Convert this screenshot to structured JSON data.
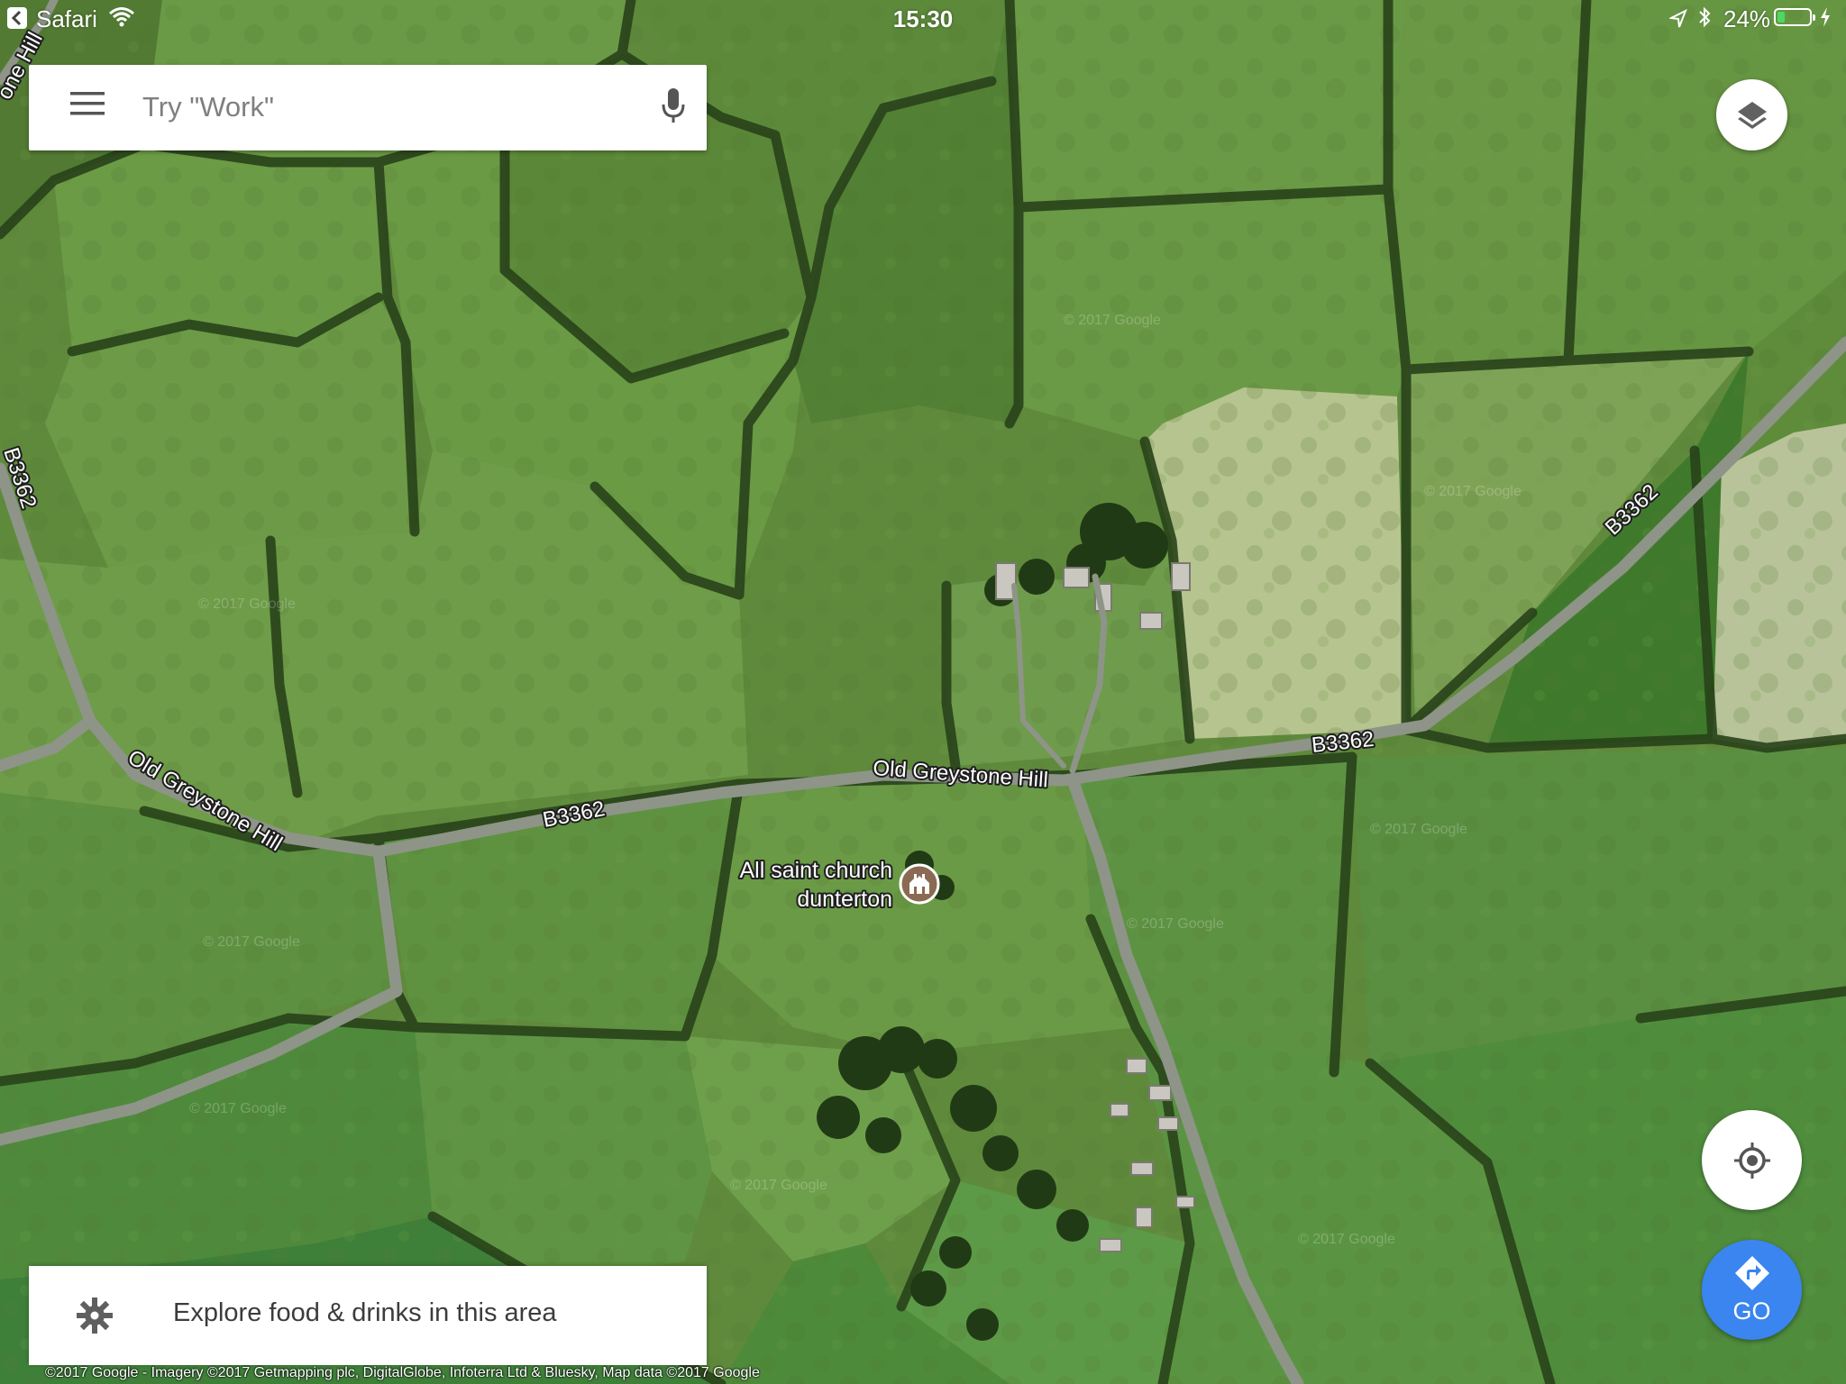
{
  "status_bar": {
    "app_name": "Safari",
    "time": "15:30",
    "battery_percent_label": "24%",
    "battery_level": 0.24,
    "icons": [
      "back-arrow-icon",
      "wifi-icon",
      "location-arrow-icon",
      "bluetooth-icon",
      "battery-icon",
      "charging-bolt-icon"
    ]
  },
  "search": {
    "placeholder": "Try \"Work\"",
    "menu_icon": "hamburger-menu-icon",
    "mic_icon": "microphone-icon"
  },
  "map": {
    "type": "satellite",
    "road_labels": {
      "top_left_partial": "one Hill",
      "b3362_left_vertical": "B3362",
      "old_greystone_hill_west": "Old Greystone Hill",
      "b3362_mid": "B3362",
      "old_greystone_hill_center": "Old Greystone Hill",
      "b3362_east": "B3362",
      "b3362_northeast": "B3362"
    },
    "poi": {
      "name_line1": "All saint church",
      "name_line2": "dunterton",
      "icon": "church-icon"
    },
    "watermark": "© 2017 Google"
  },
  "controls": {
    "layers_icon": "layers-icon",
    "locate_icon": "my-location-icon",
    "go_label": "GO",
    "go_icon": "directions-icon"
  },
  "explore": {
    "label": "Explore food & drinks in this area",
    "icon": "explore-gear-icon"
  },
  "attribution": "©2017 Google - Imagery ©2017 Getmapping plc, DigitalGlobe, Infoterra Ltd & Bluesky, Map data ©2017 Google",
  "colors": {
    "go_button": "#3a85f0",
    "field_green": "#6a9444",
    "hedgerow": "#28421a",
    "road": "#8e9488",
    "poi_marker": "#8a6a52"
  }
}
